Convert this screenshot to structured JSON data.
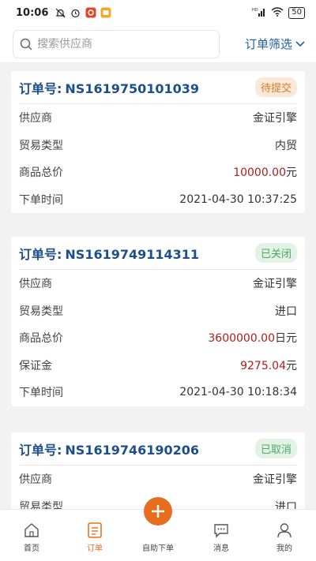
{
  "status_bar": {
    "time": "10:06",
    "network": "HD",
    "battery": "50"
  },
  "search": {
    "placeholder": "搜索供应商"
  },
  "filter": {
    "label": "订单筛选"
  },
  "labels": {
    "order_no": "订单号:",
    "supplier": "供应商",
    "trade_type": "贸易类型",
    "total_price": "商品总价",
    "deposit": "保证金",
    "order_time": "下单时间"
  },
  "orders": [
    {
      "order_no": "NS1619750101039",
      "status": "待提交",
      "supplier": "金证引擎",
      "trade_type": "内贸",
      "total_price": "10000.00",
      "total_unit": "元",
      "order_time": "2021-04-30 10:37:25"
    },
    {
      "order_no": "NS1619749114311",
      "status": "已关闭",
      "supplier": "金证引擎",
      "trade_type": "进口",
      "total_price": "3600000.00",
      "total_unit": "日元",
      "deposit": "9275.04",
      "deposit_unit": "元",
      "order_time": "2021-04-30 10:18:34"
    },
    {
      "order_no": "NS1619746190206",
      "status": "已取消",
      "supplier": "金证引擎",
      "trade_type": "进口"
    }
  ],
  "tabs": {
    "home": "首页",
    "orders": "订单",
    "self_order": "自助下单",
    "messages": "消息",
    "mine": "我的"
  },
  "colors": {
    "accent": "#e86c1e",
    "order_no": "#1d4f8a",
    "price": "#b31b1b",
    "filter": "#1d5fa8"
  }
}
